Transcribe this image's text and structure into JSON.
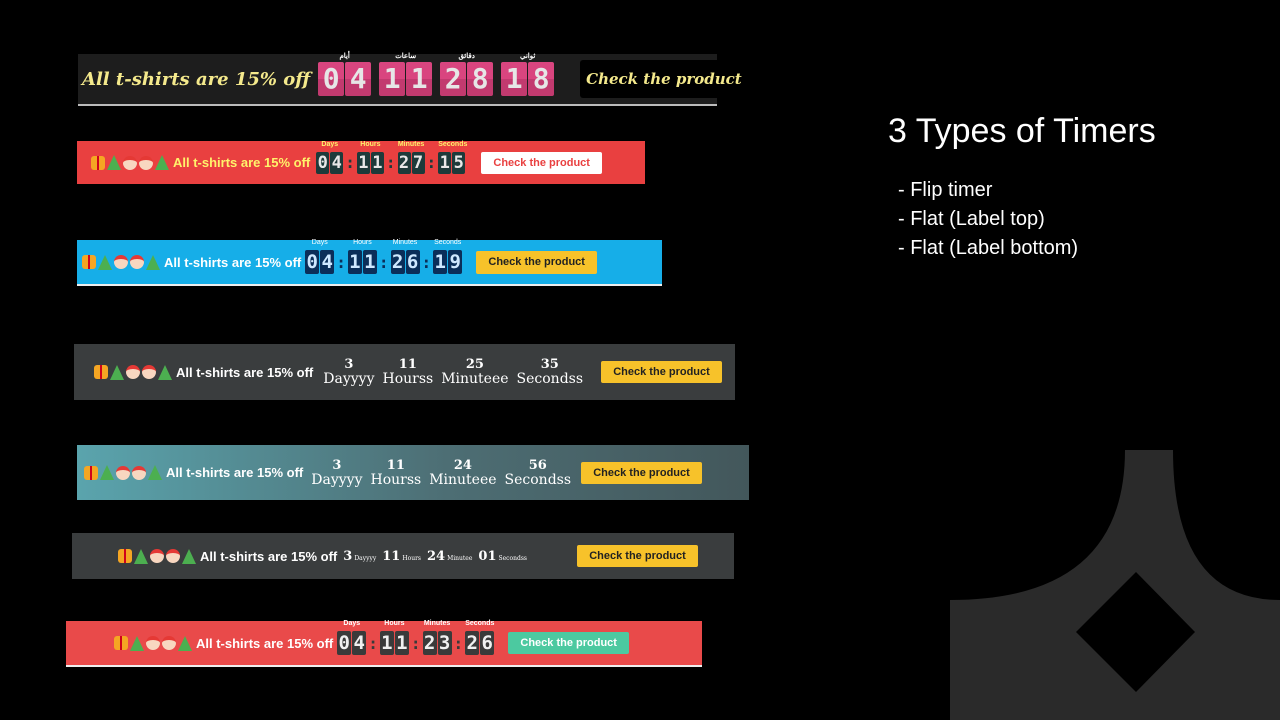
{
  "panel": {
    "title": "3 Types of Timers",
    "items": [
      "- Flip timer",
      "- Flat (Label top)",
      "- Flat (Label bottom)"
    ]
  },
  "bars": {
    "b1": {
      "message": "All t-shirts are 15% off",
      "labels": [
        "أيام",
        "ساعات",
        "دقائق",
        "ثواني"
      ],
      "digits": [
        "0",
        "4",
        "1",
        "1",
        "2",
        "8",
        "1",
        "8"
      ],
      "button": "Check the product"
    },
    "b2": {
      "message": "All t-shirts are 15% off",
      "labels": [
        "Days",
        "Hours",
        "Minutes",
        "Seconds"
      ],
      "digits": [
        "0",
        "4",
        "1",
        "1",
        "2",
        "7",
        "1",
        "5"
      ],
      "button": "Check the product"
    },
    "b3": {
      "message": "All t-shirts are 15% off",
      "labels": [
        "Days",
        "Hours",
        "Minutes",
        "Seconds"
      ],
      "digits": [
        "0",
        "4",
        "1",
        "1",
        "2",
        "6",
        "1",
        "9"
      ],
      "button": "Check the product"
    },
    "b4": {
      "message": "All t-shirts are 15% off",
      "units": [
        {
          "num": "3",
          "label": "Dayyyy"
        },
        {
          "num": "11",
          "label": "Hourss"
        },
        {
          "num": "25",
          "label": "Minuteee"
        },
        {
          "num": "35",
          "label": "Secondss"
        }
      ],
      "button": "Check the product"
    },
    "b5": {
      "message": "All t-shirts are 15% off",
      "units": [
        {
          "num": "3",
          "label": "Dayyyy"
        },
        {
          "num": "11",
          "label": "Hourss"
        },
        {
          "num": "24",
          "label": "Minuteee"
        },
        {
          "num": "56",
          "label": "Secondss"
        }
      ],
      "button": "Check the product"
    },
    "b6": {
      "message": "All t-shirts are 15% off",
      "units": [
        {
          "num": "3",
          "label": "Dayyyy"
        },
        {
          "num": "11",
          "label": "Hours"
        },
        {
          "num": "24",
          "label": "Minutee"
        },
        {
          "num": "01",
          "label": "Secondss"
        }
      ],
      "button": "Check the product"
    },
    "b7": {
      "message": "All t-shirts are 15% off",
      "labels": [
        "Days",
        "Hours",
        "Minutes",
        "Seconds"
      ],
      "digits": [
        "0",
        "4",
        "1",
        "1",
        "2",
        "3",
        "2",
        "6"
      ],
      "button": "Check the product"
    }
  },
  "colors": {
    "flip_digit": "#d9457f",
    "red_bar": "#e94040",
    "blue_bar": "#16aee8",
    "yellow_button": "#f7c22a",
    "teal_button": "#4cc9a0"
  }
}
